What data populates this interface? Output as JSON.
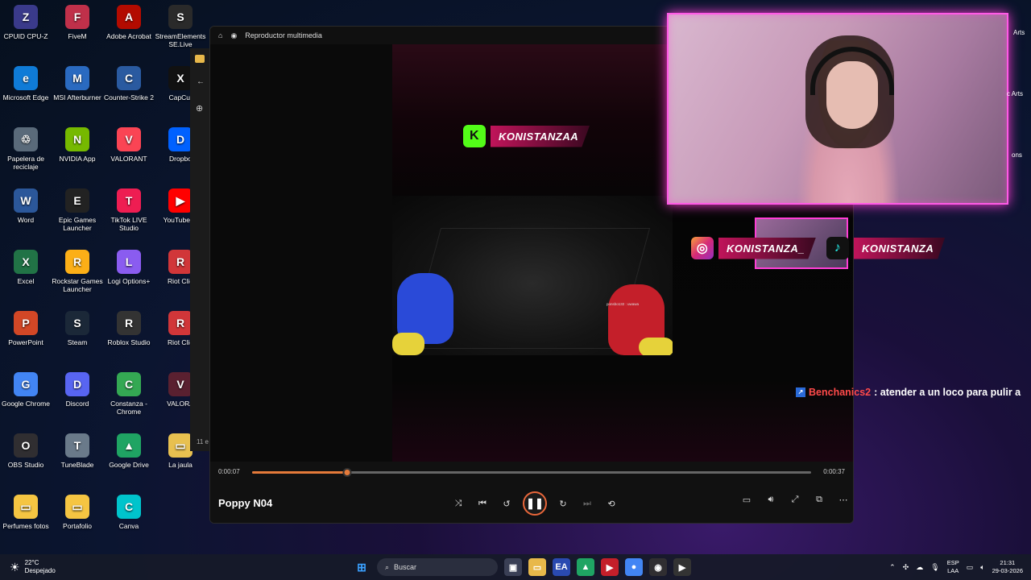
{
  "desktop": {
    "icons": [
      {
        "label": "CPUID CPU-Z",
        "color": "#3a3a8a",
        "glyph": "Z"
      },
      {
        "label": "FiveM",
        "color": "#c0304a",
        "glyph": "F"
      },
      {
        "label": "Adobe Acrobat",
        "color": "#b30b00",
        "glyph": "A"
      },
      {
        "label": "StreamElements SE.Live",
        "color": "#2a2a2a",
        "glyph": "S"
      },
      {
        "label": "Microsoft Edge",
        "color": "#0f7bd7",
        "glyph": "e"
      },
      {
        "label": "MSI Afterburner",
        "color": "#2a6ac0",
        "glyph": "M"
      },
      {
        "label": "Counter-Strike 2",
        "color": "#2a5aa0",
        "glyph": "C"
      },
      {
        "label": "CapCut",
        "color": "#111111",
        "glyph": "X"
      },
      {
        "label": "Papelera de reciclaje",
        "color": "#5a6a7a",
        "glyph": "♲"
      },
      {
        "label": "NVIDIA App",
        "color": "#76b900",
        "glyph": "N"
      },
      {
        "label": "VALORANT",
        "color": "#fa4454",
        "glyph": "V"
      },
      {
        "label": "Dropbo",
        "color": "#0061ff",
        "glyph": "D"
      },
      {
        "label": "Word",
        "color": "#2b579a",
        "glyph": "W"
      },
      {
        "label": "Epic Games Launcher",
        "color": "#222222",
        "glyph": "E"
      },
      {
        "label": "TikTok LIVE Studio",
        "color": "#ee1d52",
        "glyph": "T"
      },
      {
        "label": "YouTube M",
        "color": "#ff0000",
        "glyph": "▶"
      },
      {
        "label": "Excel",
        "color": "#217346",
        "glyph": "X"
      },
      {
        "label": "Rockstar Games Launcher",
        "color": "#fcaf17",
        "glyph": "R"
      },
      {
        "label": "Logi Options+",
        "color": "#8a5cf0",
        "glyph": "L"
      },
      {
        "label": "Riot Clie",
        "color": "#d13639",
        "glyph": "R"
      },
      {
        "label": "PowerPoint",
        "color": "#d24726",
        "glyph": "P"
      },
      {
        "label": "Steam",
        "color": "#1b2838",
        "glyph": "S"
      },
      {
        "label": "Roblox Studio",
        "color": "#333333",
        "glyph": "R"
      },
      {
        "label": "Riot Clie",
        "color": "#d13639",
        "glyph": "R"
      },
      {
        "label": "Google Chrome",
        "color": "#4285f4",
        "glyph": "G"
      },
      {
        "label": "Discord",
        "color": "#5865f2",
        "glyph": "D"
      },
      {
        "label": "Constanza - Chrome",
        "color": "#34a853",
        "glyph": "C"
      },
      {
        "label": "VALORA",
        "color": "#5a2030",
        "glyph": "V"
      },
      {
        "label": "OBS Studio",
        "color": "#302e31",
        "glyph": "O"
      },
      {
        "label": "TuneBlade",
        "color": "#6a7a8a",
        "glyph": "T"
      },
      {
        "label": "Google Drive",
        "color": "#1fa463",
        "glyph": "▲"
      },
      {
        "label": "La jaula",
        "color": "#e8c050",
        "glyph": "▭"
      },
      {
        "label": "Perfumes fotos",
        "color": "#f5c542",
        "glyph": "▭"
      },
      {
        "label": "Portafolio",
        "color": "#f5c542",
        "glyph": "▭"
      },
      {
        "label": "Canva",
        "color": "#00c4cc",
        "glyph": "C"
      }
    ]
  },
  "player": {
    "app_title": "Reproductor multimedia",
    "media_title": "Poppy N04",
    "elapsed": "0:00:07",
    "duration": "0:00:37",
    "progress_fraction": 0.17,
    "overlay_tag": "KONISTANZAA",
    "mini_tags": [
      "KONISTANZA_",
      "KONISTANZA"
    ],
    "scene_caption": "ponsbo132 : uwawa"
  },
  "stream": {
    "instagram_tag": "KONISTANZA_",
    "tiktok_tag": "KONISTANZA",
    "chat": {
      "user": "Benchanics2",
      "message": ": atender a un loco para pulir a",
      "user_color": "#ff4a4a"
    }
  },
  "side_strip": {
    "date_fragment": "11 e"
  },
  "edge_labels": [
    "Arts",
    "c Arts",
    "ons"
  ],
  "taskbar": {
    "weather_temp": "22°C",
    "weather_desc": "Despejado",
    "search_placeholder": "Buscar",
    "lang_line1": "ESP",
    "lang_line2": "LAA",
    "time": "21:31",
    "date": "29-03-2026"
  },
  "colors": {
    "accent_orange": "#e57a3a",
    "neon_pink": "#ff3ed6"
  }
}
